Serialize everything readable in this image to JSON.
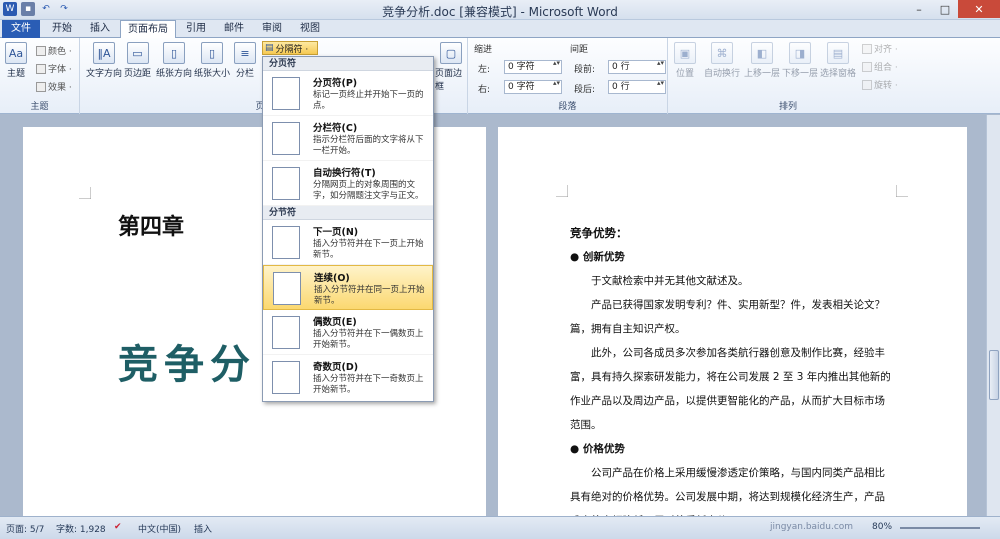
{
  "window": {
    "title": "竞争分析.doc [兼容模式] - Microsoft Word"
  },
  "tabs": [
    "文件",
    "开始",
    "插入",
    "页面布局",
    "引用",
    "邮件",
    "审阅",
    "视图"
  ],
  "ribbon": {
    "theme_group": "主题",
    "theme_btn": "主题",
    "colors": "颜色 ·",
    "fonts": "字体 ·",
    "effects": "效果 ·",
    "page_setup_group": "页面设置",
    "text_dir": "文字方向",
    "margins": "页边距",
    "orientation": "纸张方向",
    "size": "纸张大小",
    "columns": "分栏",
    "breaks_btn": "分隔符 ·",
    "page_border": "页面边框",
    "indent_label": "缩进",
    "indent_left": "左:",
    "indent_left_val": "0 字符",
    "indent_right": "右:",
    "indent_right_val": "0 字符",
    "spacing_label": "间距",
    "spacing_before": "段前:",
    "spacing_before_val": "0 行",
    "spacing_after": "段后:",
    "spacing_after_val": "0 行",
    "paragraph_group": "段落",
    "position": "位置",
    "wrap": "自动换行",
    "forward": "上移一层",
    "backward": "下移一层",
    "selection_pane": "选择窗格",
    "align": "对齐 ·",
    "group": "组合 ·",
    "rotate": "旋转 ·",
    "arrange_group": "排列"
  },
  "breaks_menu": {
    "page_section": "分页符",
    "items1": [
      {
        "title": "分页符(P)",
        "desc": "标记一页终止并开始下一页的点。"
      },
      {
        "title": "分栏符(C)",
        "desc": "指示分栏符后面的文字将从下一栏开始。"
      },
      {
        "title": "自动换行符(T)",
        "desc": "分隔网页上的对象周围的文字，如分隔题注文字与正文。"
      }
    ],
    "section_section": "分节符",
    "items2": [
      {
        "title": "下一页(N)",
        "desc": "插入分节符并在下一页上开始新节。"
      },
      {
        "title": "连续(O)",
        "desc": "插入分节符并在同一页上开始新节。"
      },
      {
        "title": "偶数页(E)",
        "desc": "插入分节符并在下一偶数页上开始新节。"
      },
      {
        "title": "奇数页(D)",
        "desc": "插入分节符并在下一奇数页上开始新节。"
      }
    ]
  },
  "page1": {
    "chapter": "第四章",
    "big_title": "竞争分"
  },
  "page2": {
    "heading": "竞争优势：",
    "b1": "创新优势",
    "p1": "于文献检索中并无其他文献述及。",
    "p2a": "产品已获得国家发明专利？件、实用新型？件，发表相关论文？",
    "p2b": "篇，拥有自主知识产权。",
    "p3a": "此外，公司各成员多次参加各类航行器创意及制作比赛，经验丰",
    "p3b": "富，具有持久探索研发能力，将在公司发展 2 至 3 年内推出其他新的",
    "p3c": "作业产品以及周边产品，以提供更智能化的产品，从而扩大目标市场",
    "p3d": "范围。",
    "b2": "价格优势",
    "p4a": "公司产品在价格上采用缓慢渗透定价策略，与国内同类产品相比",
    "p4b": "具有绝对的价格优势。公司发展中期，将达到规模化经济生产，产品",
    "p4c": "成本将大幅降低，届时将重新定价。"
  },
  "status": {
    "page": "页面: 5/7",
    "words": "字数: 1,928",
    "lang": "中文(中国)",
    "mode": "插入",
    "zoom": "80%",
    "watermark": "jingyan.baidu.com"
  }
}
